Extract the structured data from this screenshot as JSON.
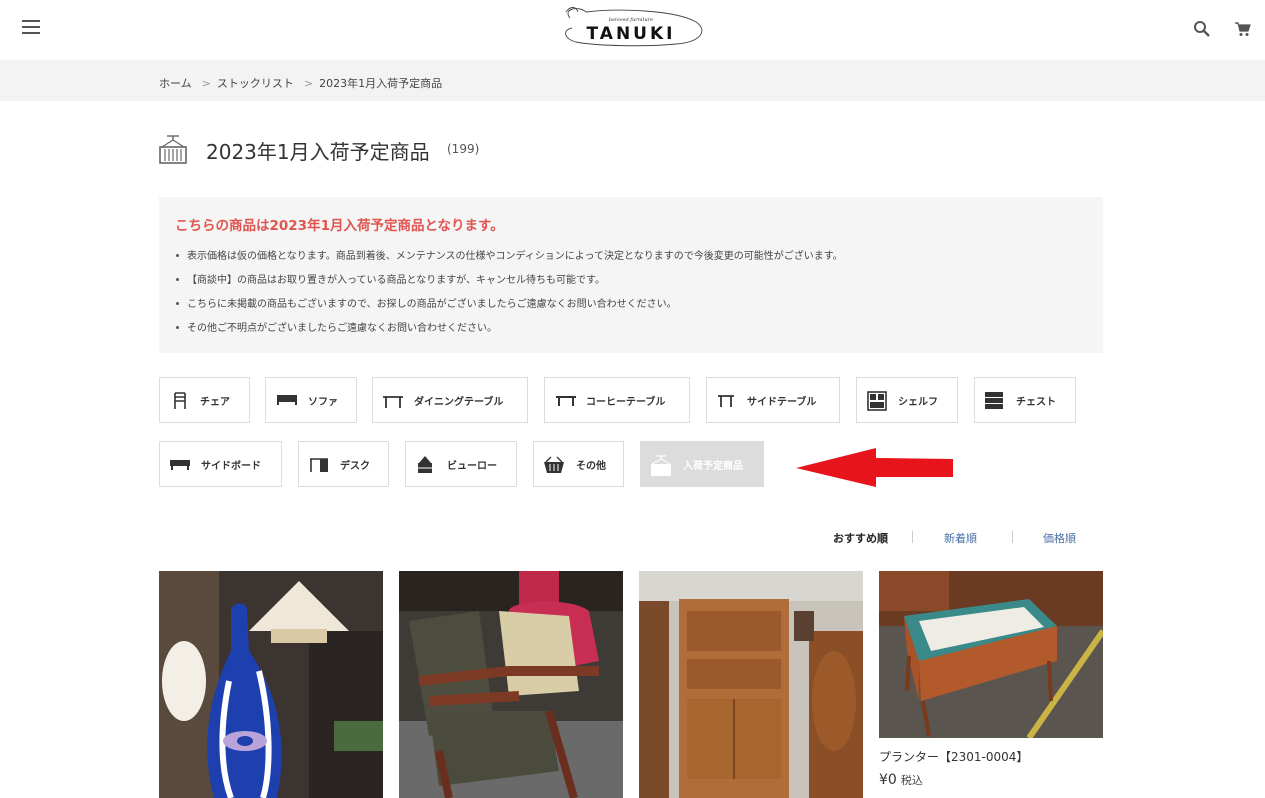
{
  "header": {
    "logo_text": "TANUKI",
    "logo_subtitle": "beloved furniture"
  },
  "breadcrumb": [
    "ホーム",
    "ストックリスト",
    "2023年1月入荷予定商品"
  ],
  "page": {
    "title": "2023年1月入荷予定商品",
    "count": "(199)"
  },
  "notice": {
    "heading": "こちらの商品は2023年1月入荷予定商品となります。",
    "items": [
      "表示価格は仮の価格となります。商品到着後、メンテナンスの仕様やコンディションによって決定となりますので今後変更の可能性がございます。",
      "【商談中】の商品はお取り置きが入っている商品となりますが、キャンセル待ちも可能です。",
      "こちらに未掲載の商品もございますので、お探しの商品がございましたらご遠慮なくお問い合わせください。",
      "その他ご不明点がございましたらご遠慮なくお問い合わせください。"
    ]
  },
  "categories": [
    {
      "label": "チェア",
      "icon": "chair-icon"
    },
    {
      "label": "ソファ",
      "icon": "sofa-icon"
    },
    {
      "label": "ダイニングテーブル",
      "icon": "dining-table-icon"
    },
    {
      "label": "コーヒーテーブル",
      "icon": "coffee-table-icon"
    },
    {
      "label": "サイドテーブル",
      "icon": "side-table-icon"
    },
    {
      "label": "シェルフ",
      "icon": "shelf-icon"
    },
    {
      "label": "チェスト",
      "icon": "chest-icon"
    },
    {
      "label": "サイドボード",
      "icon": "sideboard-icon"
    },
    {
      "label": "デスク",
      "icon": "desk-icon"
    },
    {
      "label": "ビューロー",
      "icon": "bureau-icon"
    },
    {
      "label": "その他",
      "icon": "basket-icon"
    },
    {
      "label": "入荷予定商品",
      "icon": "container-icon",
      "active": true
    }
  ],
  "sort": {
    "recommended": "おすすめ順",
    "newest": "新着順",
    "price": "価格順"
  },
  "products": [
    {
      "name": "",
      "price": ""
    },
    {
      "name": "",
      "price": ""
    },
    {
      "name": "",
      "price": ""
    },
    {
      "name": "プランター【2301-0004】",
      "price": "¥0",
      "tax": "税込"
    }
  ],
  "colors": {
    "accent_red": "#e0554f",
    "arrow_red": "#e8141c",
    "sort_link_blue": "#4a6fa5",
    "notice_bg": "#f5f5f5",
    "breadcrumb_bg": "#f3f3f3",
    "active_category_bg": "#dcdcdc"
  }
}
